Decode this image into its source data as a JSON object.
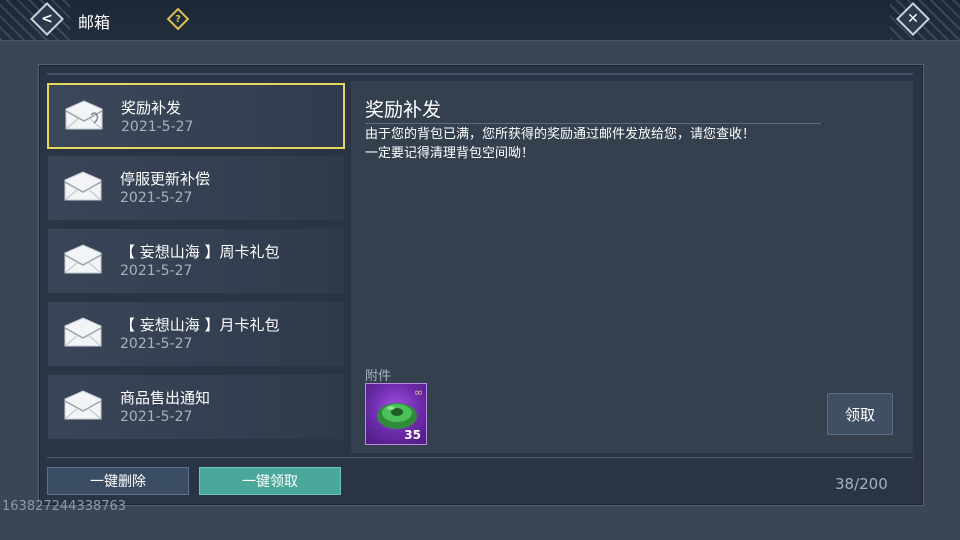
{
  "header": {
    "title": "邮箱",
    "back_icon": "back-chevron-icon",
    "help_icon": "help-question-icon",
    "close_icon": "close-icon"
  },
  "mail_list": [
    {
      "title": "奖励补发",
      "date": "2021-5-27",
      "selected": true
    },
    {
      "title": "停服更新补偿",
      "date": "2021-5-27",
      "selected": false
    },
    {
      "title": "【 妄想山海 】周卡礼包",
      "date": "2021-5-27",
      "selected": false
    },
    {
      "title": "【 妄想山海 】月卡礼包",
      "date": "2021-5-27",
      "selected": false
    },
    {
      "title": "商品售出通知",
      "date": "2021-5-27",
      "selected": false
    }
  ],
  "detail": {
    "title": "奖励补发",
    "body_line1": "由于您的背包已满，您所获得的奖励通过邮件发放给您，请您查收！",
    "body_line2": "一定要记得清理背包空间呦！",
    "attachment_label": "附件",
    "attachment": {
      "quantity": "35",
      "icon": "green-jade-item-icon",
      "bound_icon": "chain-icon"
    },
    "claim_label": "领取"
  },
  "footer": {
    "delete_all_label": "一键删除",
    "claim_all_label": "一键领取",
    "mail_count": "38/200"
  },
  "watermark": "163827244338763",
  "colors": {
    "selected_border": "#e6d660",
    "claim_all_bg": "#4aa89a",
    "help_icon": "#d8c14f"
  }
}
